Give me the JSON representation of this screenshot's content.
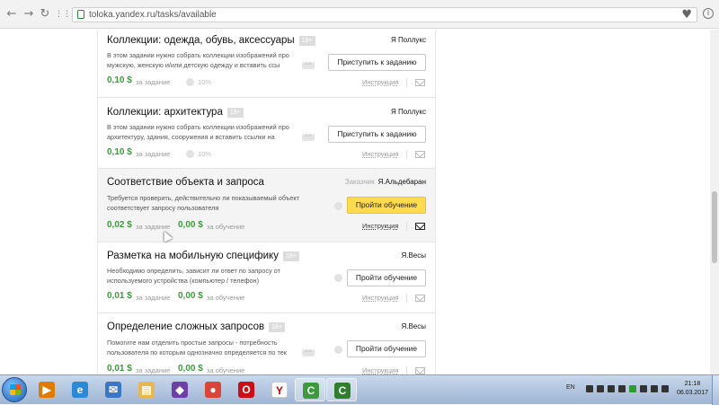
{
  "browser": {
    "url": "toloka.yandex.ru/tasks/available",
    "back_icon": "←",
    "forward_icon": "→",
    "reload_icon": "↻",
    "apps_icon": "⋮⋮",
    "bookmark_icon": "♥",
    "info_icon": "i"
  },
  "tasks": [
    {
      "title": "Коллекции: одежда, обувь, аксессуары",
      "badge": "18+",
      "requester_label": "",
      "requester": "Я Поллукс",
      "description_line1": "В этом задании нужно собрать коллекции изображений про",
      "description_line2": "мужскую, женскую и/или детскую одежду и вставить ссы",
      "more": "···",
      "button": "Приступить к заданию",
      "price": "0,10 $",
      "price_label": "за задание",
      "training_price": "",
      "training_label": "",
      "percent": "10%",
      "instruction": "Инструкция"
    },
    {
      "title": "Коллекции: архитектура",
      "badge": "18+",
      "requester_label": "",
      "requester": "Я Поллукс",
      "description_line1": "В этом задании нужно собрать коллекции изображений про",
      "description_line2": "архитектуру, здания, сооружения и вставить ссылки на",
      "more": "···",
      "button": "Приступить к заданию",
      "price": "0,10 $",
      "price_label": "за задание",
      "training_price": "",
      "training_label": "",
      "percent": "10%",
      "instruction": "Инструкция"
    },
    {
      "title": "Соответствие объекта и запроса",
      "badge": "",
      "requester_label": "Заказчик",
      "requester": "Я.Альдебаран",
      "description_line1": "Требуется проверить, действительно ли показываемый объект",
      "description_line2": "соответствует запросу пользователя",
      "more": "···",
      "button": "Пройти обучение",
      "price": "0,02 $",
      "price_label": "за задание",
      "training_price": "0,00 $",
      "training_label": "за обучение",
      "percent": "",
      "instruction": "Инструкция"
    },
    {
      "title": "Разметка на мобильную специфику",
      "badge": "18+",
      "requester_label": "",
      "requester": "Я.Весы",
      "description_line1": "Необходимо определить, зависит ли ответ по запросу от",
      "description_line2": "используемого устройства (компьютер / телефон)",
      "more": "",
      "button": "Пройти обучение",
      "price": "0,01 $",
      "price_label": "за задание",
      "training_price": "0,00 $",
      "training_label": "за обучение",
      "percent": "",
      "instruction": "Инструкция"
    },
    {
      "title": "Определение сложных запросов",
      "badge": "18+",
      "requester_label": "",
      "requester": "Я.Весы",
      "description_line1": "Помогите нам отделить простые запросы - потребность",
      "description_line2": "пользователя по которым однозначно определяется по тек",
      "more": "···",
      "button": "Пройти обучение",
      "price": "0,01 $",
      "price_label": "за задание",
      "training_price": "0,00 $",
      "training_label": "за обучение",
      "percent": "",
      "instruction": "Инструкция"
    }
  ],
  "taskbar": {
    "lang": "EN",
    "time": "21:18",
    "date": "06.03.2017",
    "apps": [
      {
        "icon": "windows-media-player-icon",
        "glyph": "▶",
        "color": "#e07b00"
      },
      {
        "icon": "internet-explorer-icon",
        "glyph": "e",
        "color": "#2b8ad8"
      },
      {
        "icon": "mail-icon",
        "glyph": "✉",
        "color": "#3a77c7"
      },
      {
        "icon": "folder-icon",
        "glyph": "▤",
        "color": "#e8b84a"
      },
      {
        "icon": "visual-studio-icon",
        "glyph": "◆",
        "color": "#6f3fa8"
      },
      {
        "icon": "chrome-icon",
        "glyph": "●",
        "color": "#db4437"
      },
      {
        "icon": "opera-icon",
        "glyph": "O",
        "color": "#cc0f16"
      },
      {
        "icon": "yandex-browser-icon",
        "glyph": "Y",
        "color": "#ffffff"
      },
      {
        "icon": "camtasia-icon",
        "glyph": "C",
        "color": "#3c9a3c"
      },
      {
        "icon": "camtasia-recorder-icon",
        "glyph": "C",
        "color": "#2f7f2f"
      }
    ]
  }
}
